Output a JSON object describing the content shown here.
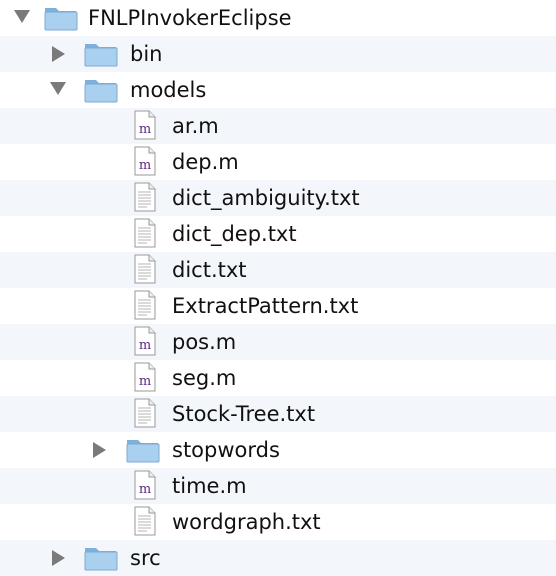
{
  "tree": {
    "root": {
      "label": "FNLPInvokerEclipse",
      "icon": "folder-icon",
      "expanded": true
    },
    "bin": {
      "label": "bin",
      "icon": "folder-icon",
      "expanded": false
    },
    "models": {
      "label": "models",
      "icon": "folder-icon",
      "expanded": true
    },
    "files": [
      {
        "label": "ar.m",
        "icon": "m-file-icon"
      },
      {
        "label": "dep.m",
        "icon": "m-file-icon"
      },
      {
        "label": "dict_ambiguity.txt",
        "icon": "text-file-icon"
      },
      {
        "label": "dict_dep.txt",
        "icon": "text-file-icon"
      },
      {
        "label": "dict.txt",
        "icon": "text-file-icon"
      },
      {
        "label": "ExtractPattern.txt",
        "icon": "text-file-icon"
      },
      {
        "label": "pos.m",
        "icon": "m-file-icon"
      },
      {
        "label": "seg.m",
        "icon": "m-file-icon"
      },
      {
        "label": "Stock-Tree.txt",
        "icon": "text-file-icon"
      }
    ],
    "stopwords": {
      "label": "stopwords",
      "icon": "folder-icon",
      "expanded": false
    },
    "files2": [
      {
        "label": "time.m",
        "icon": "m-file-icon"
      },
      {
        "label": "wordgraph.txt",
        "icon": "text-file-icon"
      }
    ],
    "src": {
      "label": "src",
      "icon": "folder-icon",
      "expanded": false
    },
    "m_glyph": "m"
  },
  "colors": {
    "stripe": "#f3f6fb",
    "folder": "#9ec8ea",
    "triangle": "#7a7a7a"
  }
}
